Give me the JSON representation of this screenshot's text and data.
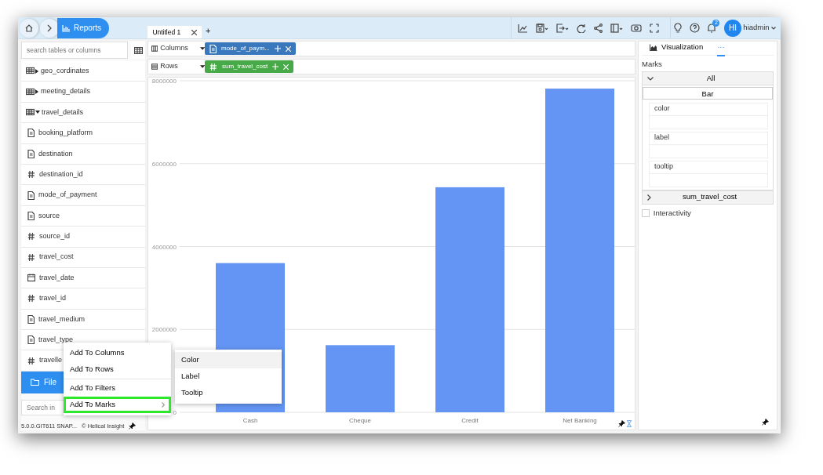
{
  "breadcrumb": {
    "label": "Reports"
  },
  "report_tabs": [
    {
      "label": "Untitled 1",
      "selected": true
    }
  ],
  "add_tab": "+",
  "notifications": {
    "count": "2"
  },
  "user": {
    "initials": "HI",
    "name": "hiadmin"
  },
  "sidebar": {
    "search": {
      "placeholder": "search tables or columns"
    },
    "tree": [
      {
        "label": "geo_cordinates",
        "kind": "table",
        "expanded": false
      },
      {
        "label": "meeting_details",
        "kind": "table",
        "expanded": false
      },
      {
        "label": "travel_details",
        "kind": "table",
        "expanded": true,
        "children": [
          {
            "label": "booking_platform",
            "kind": "text"
          },
          {
            "label": "destination",
            "kind": "text"
          },
          {
            "label": "destination_id",
            "kind": "number"
          },
          {
            "label": "mode_of_payment",
            "kind": "text"
          },
          {
            "label": "source",
            "kind": "text"
          },
          {
            "label": "source_id",
            "kind": "number"
          },
          {
            "label": "travel_cost",
            "kind": "number"
          },
          {
            "label": "travel_date",
            "kind": "date"
          },
          {
            "label": "travel_id",
            "kind": "number"
          },
          {
            "label": "travel_medium",
            "kind": "text"
          },
          {
            "label": "travel_type",
            "kind": "text"
          },
          {
            "label": "travelle",
            "kind": "number"
          }
        ]
      }
    ],
    "file_browser": {
      "label": "File"
    },
    "insight_search": {
      "placeholder": "Search in"
    },
    "version": "5.0.0.GIT611 SNAP...",
    "brand": "© Helical Insight"
  },
  "shelves": [
    {
      "label": "Columns",
      "kind": "columns",
      "pill": {
        "label": "mode_of_paym...",
        "kind": "text",
        "color": "#3a78bd"
      }
    },
    {
      "label": "Rows",
      "kind": "rows",
      "pill": {
        "label": "sum_travel_cost",
        "kind": "number",
        "color": "#48a948"
      }
    }
  ],
  "chart_data": {
    "type": "bar",
    "categories": [
      "Cash",
      "Cheque",
      "Credit",
      "Net Banking"
    ],
    "series": [
      {
        "color": "#6495f5",
        "values": [
          3600000,
          1620000,
          5430000,
          7810000
        ]
      }
    ],
    "grid": true,
    "ylim": [
      0,
      8000000
    ],
    "yticks": [
      0,
      2000000,
      4000000,
      6000000,
      8000000
    ]
  },
  "context_menu": {
    "groups": [
      [
        {
          "label": "Add To Columns",
          "highlighted": false,
          "submenu": false
        },
        {
          "label": "Add To Rows",
          "highlighted": false,
          "submenu": false
        }
      ],
      [
        {
          "label": "Add To Filters",
          "highlighted": false,
          "submenu": false
        },
        {
          "label": "Add To Marks",
          "highlighted": true,
          "submenu": true
        }
      ]
    ],
    "submenu": [
      {
        "label": "Color",
        "selected": true
      },
      {
        "label": "Label",
        "selected": false
      },
      {
        "label": "Tooltip",
        "selected": false
      }
    ]
  },
  "right_panel": {
    "tabs": [
      {
        "label": "Visualization",
        "selected": false
      },
      {
        "label": "···",
        "selected": true
      }
    ],
    "marks_title": "Marks",
    "groups": [
      {
        "label": "All",
        "expanded": true,
        "type_button": "Bar",
        "slots": [
          "color",
          "label",
          "tooltip"
        ]
      },
      {
        "label": "sum_travel_cost",
        "expanded": false
      }
    ],
    "interactivity": {
      "label": "Interactivity",
      "checked": false
    }
  }
}
